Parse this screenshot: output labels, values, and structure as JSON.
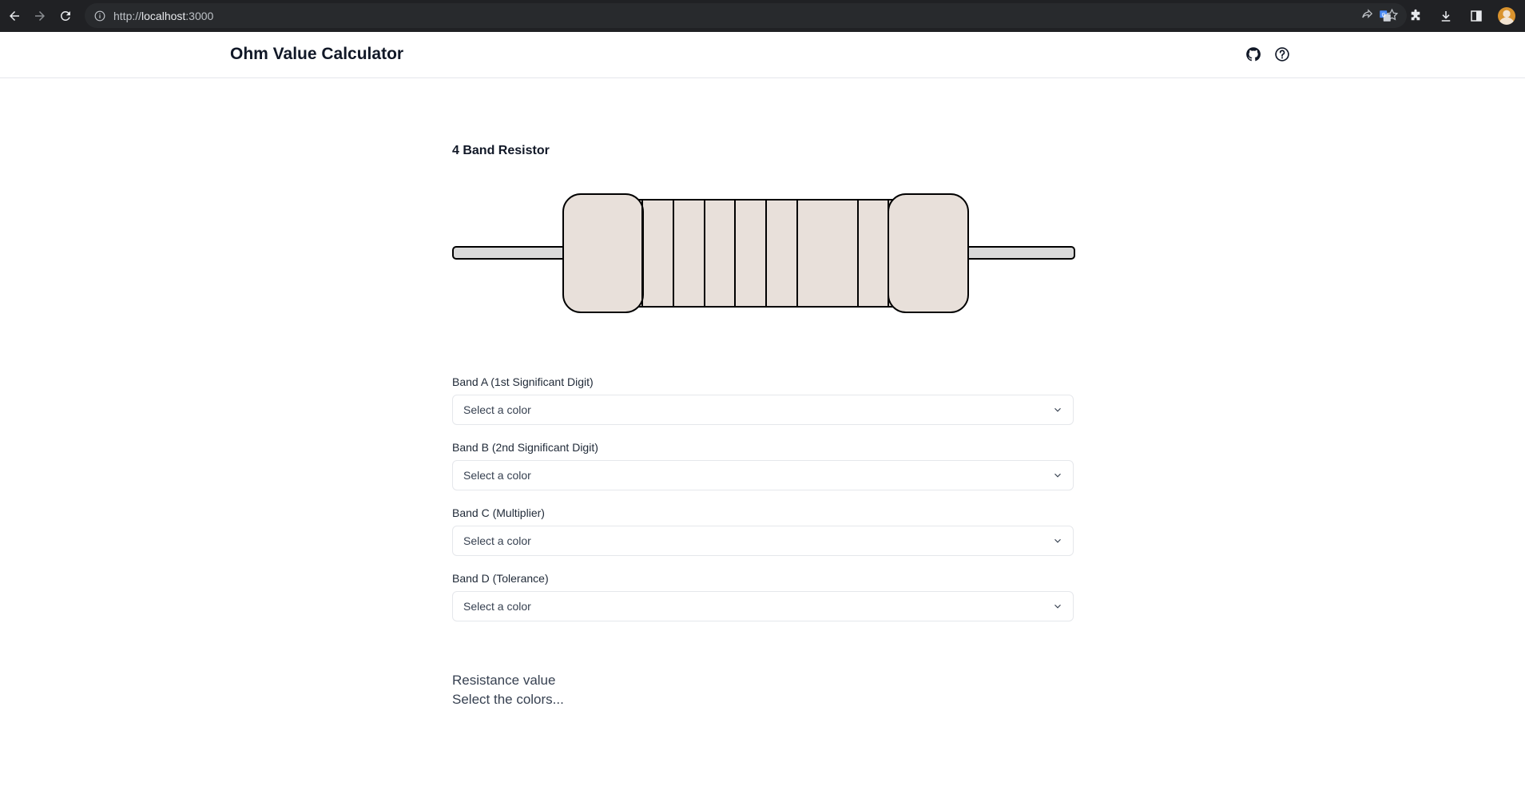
{
  "browser": {
    "url_prefix": "http://",
    "url_host": "localhost",
    "url_port": ":3000"
  },
  "header": {
    "title": "Ohm Value Calculator",
    "icons": [
      "github-icon",
      "help-circle-icon"
    ]
  },
  "main": {
    "title": "4 Band Resistor",
    "bands": [
      {
        "label": "Band A (1st Significant Digit)",
        "value": "Select a color"
      },
      {
        "label": "Band B (2nd Significant Digit)",
        "value": "Select a color"
      },
      {
        "label": "Band C (Multiplier)",
        "value": "Select a color"
      },
      {
        "label": "Band D (Tolerance)",
        "value": "Select a color"
      }
    ],
    "result": {
      "label": "Resistance value",
      "value": "Select the colors..."
    }
  },
  "colors": {
    "body_fill": "#e8e0da",
    "lead_fill": "#d9d9d9",
    "chrome_bg": "#202124"
  }
}
